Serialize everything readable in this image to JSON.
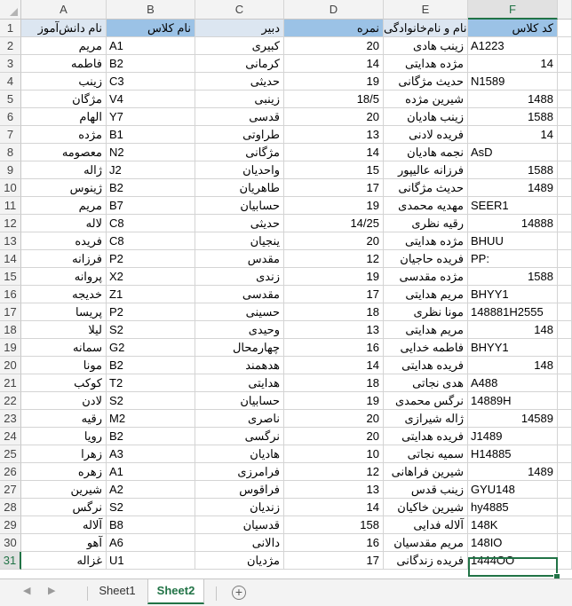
{
  "columns": [
    {
      "letter": "A"
    },
    {
      "letter": "B"
    },
    {
      "letter": "C"
    },
    {
      "letter": "D"
    },
    {
      "letter": "E"
    },
    {
      "letter": "F"
    }
  ],
  "rows": [
    [
      "نام دانش‌آموز",
      "نام کلاس",
      "دبیر",
      "نمره",
      "نام و نام‌خانوادگی",
      "کد کلاس"
    ],
    [
      "مریم",
      "A1",
      "کبیری",
      "20",
      "زینب هادی",
      "A1223"
    ],
    [
      "فاطمه",
      "B2",
      "کرمانی",
      "14",
      "مژده هدایتی",
      "14"
    ],
    [
      "زینب",
      "C3",
      "حدیثی",
      "19",
      "حدیث مژگانی",
      "N1589"
    ],
    [
      "مژگان",
      "V4",
      "زینبی",
      "18/5",
      "شیرین مژده",
      "1488"
    ],
    [
      "الهام",
      "Y7",
      "قدسی",
      "20",
      "زینب هادیان",
      "1588"
    ],
    [
      "مژده",
      "B1",
      "طراوتی",
      "13",
      "فریده لادنی",
      "14"
    ],
    [
      "معصومه",
      "N2",
      "مژگانی",
      "14",
      "نجمه هادیان",
      "AsD"
    ],
    [
      "ژاله",
      "J2",
      "واحدیان",
      "15",
      "فرزانه عالیپور",
      "1588"
    ],
    [
      "ژینوس",
      "B2",
      "طاهریان",
      "17",
      "حدیث مژگانی",
      "1489"
    ],
    [
      "مریم",
      "B7",
      "حسابیان",
      "19",
      "مهدیه محمدی",
      "SEER1"
    ],
    [
      "لاله",
      "C8",
      "حدیثی",
      "14/25",
      "رقیه نظری",
      "14888"
    ],
    [
      "فریده",
      "C8",
      "ینجیان",
      "20",
      "مژده هدایتی",
      "BHUU"
    ],
    [
      "فرزانه",
      "P2",
      "مقدس",
      "12",
      "فریده حاجیان",
      "PP:"
    ],
    [
      "پروانه",
      "X2",
      "زندی",
      "19",
      "مژده مقدسی",
      "1588"
    ],
    [
      "خدیجه",
      "Z1",
      "مقدسی",
      "17",
      "مریم هدایتی",
      "BHYY1"
    ],
    [
      "پریسا",
      "P2",
      "حسینی",
      "18",
      "مونا نظری",
      "148881H2555"
    ],
    [
      "لیلا",
      "S2",
      "وحیدی",
      "13",
      "مریم هدایتی",
      "148"
    ],
    [
      "سمانه",
      "G2",
      "چهارمحال",
      "16",
      "فاطمه خدایی",
      "BHYY1"
    ],
    [
      "مونا",
      "B2",
      "هدهمند",
      "14",
      "فریده هدایتی",
      "148"
    ],
    [
      "کوکب",
      "T2",
      "هدایتی",
      "18",
      "هدی نجاتی",
      "A488"
    ],
    [
      "لادن",
      "S2",
      "حسابیان",
      "19",
      "نرگس محمدی",
      "14889H"
    ],
    [
      "رقیه",
      "M2",
      "ناصری",
      "20",
      "ژاله شیرازی",
      "14589"
    ],
    [
      "رویا",
      "B2",
      "نرگسی",
      "20",
      "فریده هدایتی",
      "J1489"
    ],
    [
      "زهرا",
      "A3",
      "هادیان",
      "10",
      "سمیه نجاتی",
      "H14885"
    ],
    [
      "زهره",
      "A1",
      "فرامرزی",
      "12",
      "شیرین فراهانی",
      "1489"
    ],
    [
      "شیرین",
      "A2",
      "فراقوس",
      "13",
      "زینب قدس",
      "GYU148"
    ],
    [
      "نرگس",
      "S2",
      "زندیان",
      "14",
      "شیرین خاکیان",
      "hy4885"
    ],
    [
      "آلاله",
      "B8",
      "قدسیان",
      "158",
      "آلاله فدایی",
      "148K"
    ],
    [
      "آهو",
      "A6",
      "دالانی",
      "16",
      "مریم مقدسیان",
      "148IO"
    ],
    [
      "غزاله",
      "U1",
      "مژدیان",
      "17",
      "فریده زندگانی",
      "1444OO"
    ]
  ],
  "sheet_tabs": [
    {
      "label": "Sheet1",
      "active": false
    },
    {
      "label": "Sheet2",
      "active": true
    }
  ],
  "nav": {
    "prev": "◀",
    "next": "▶"
  },
  "add_sheet_symbol": "+",
  "selected_cell": "F31",
  "colors": {
    "header_fill": "#dce6f1",
    "header_fill_dark": "#9bc2e6",
    "accent": "#217346"
  }
}
